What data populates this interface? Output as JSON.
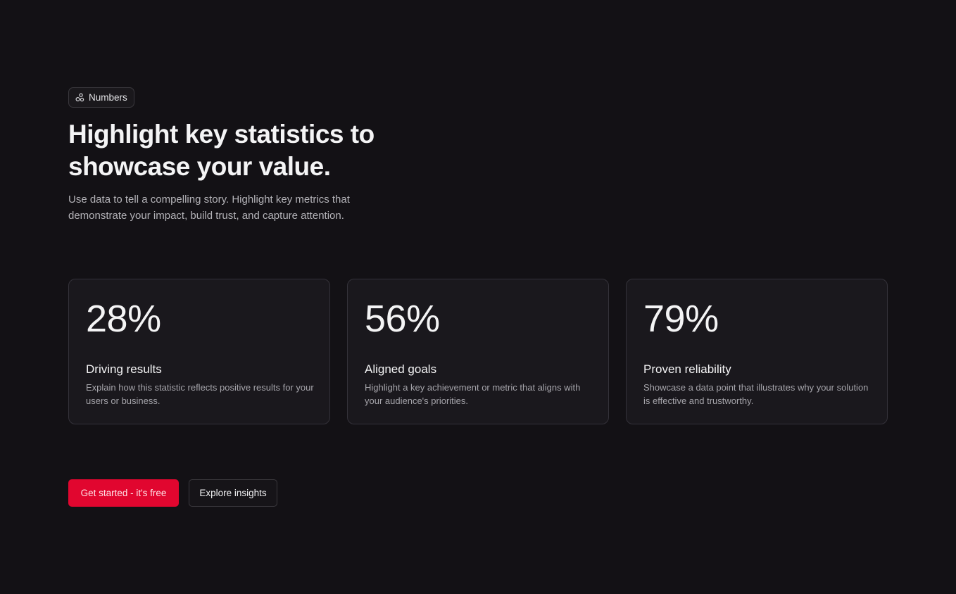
{
  "badge": {
    "icon": "shapes-icon",
    "label": "Numbers"
  },
  "hero": {
    "headline": "Highlight key statistics to showcase your value.",
    "subtitle": "Use data to tell a compelling story. Highlight key metrics that demonstrate your impact, build trust, and capture attention."
  },
  "stats": [
    {
      "value": "28%",
      "title": "Driving results",
      "description": "Explain how this statistic reflects positive results for your users or business."
    },
    {
      "value": "56%",
      "title": "Aligned goals",
      "description": "Highlight a key achievement or metric that aligns with your audience's priorities."
    },
    {
      "value": "79%",
      "title": "Proven reliability",
      "description": "Showcase a data point that illustrates why your solution is effective and trustworthy."
    }
  ],
  "actions": {
    "primary_label": "Get started - it's free",
    "secondary_label": "Explore insights"
  },
  "colors": {
    "background": "#131115",
    "accent": "#e1062f",
    "card": "#1a181d"
  }
}
